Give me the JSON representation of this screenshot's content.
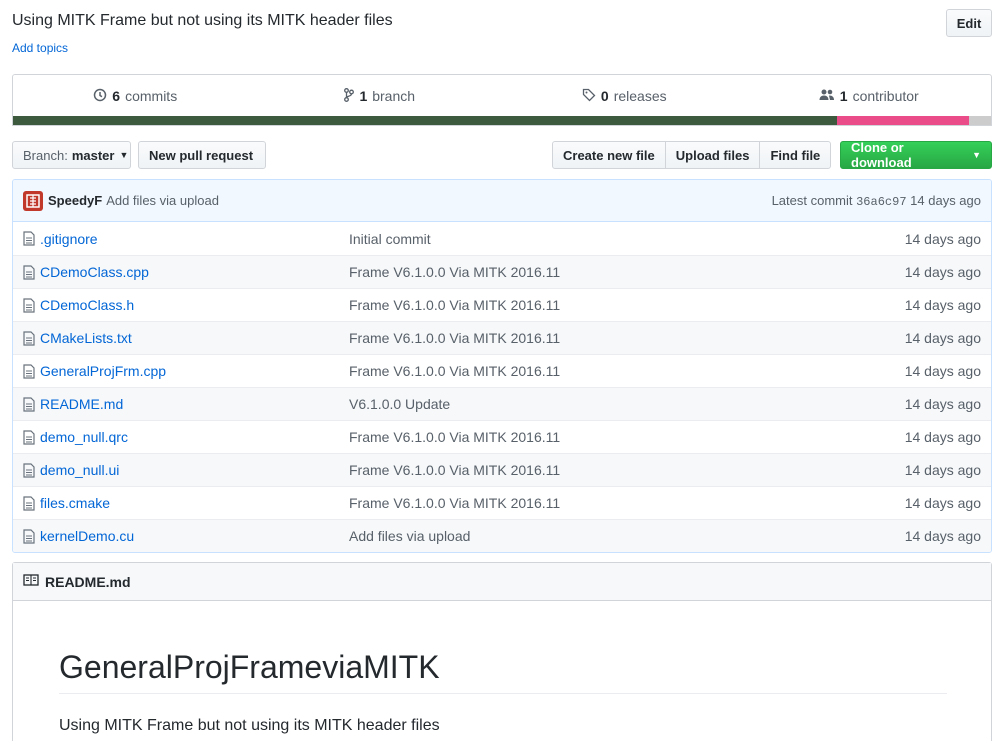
{
  "repo": {
    "description": "Using MITK Frame but not using its MITK header files",
    "add_topics": "Add topics",
    "edit_label": "Edit"
  },
  "summary": {
    "commits_count": "6",
    "commits_label": "commits",
    "branch_count": "1",
    "branch_label": "branch",
    "releases_count": "0",
    "releases_label": "releases",
    "contributor_count": "1",
    "contributor_label": "contributor",
    "language_colors": [
      "#3d5a3e",
      "#ea4c89",
      "#cccccc"
    ],
    "language_fractions": [
      0.843,
      0.135,
      0.022
    ]
  },
  "toolbar": {
    "branch_prefix": "Branch:",
    "branch_name": "master",
    "new_pr": "New pull request",
    "create_file": "Create new file",
    "upload_files": "Upload files",
    "find_file": "Find file",
    "clone": "Clone or download"
  },
  "latest_commit": {
    "author": "SpeedyF",
    "message": "Add files via upload",
    "label": "Latest commit",
    "sha": "36a6c97",
    "age": "14 days ago"
  },
  "files": [
    {
      "name": ".gitignore",
      "message": "Initial commit",
      "age": "14 days ago"
    },
    {
      "name": "CDemoClass.cpp",
      "message": "Frame V6.1.0.0 Via MITK 2016.11",
      "age": "14 days ago"
    },
    {
      "name": "CDemoClass.h",
      "message": "Frame V6.1.0.0 Via MITK 2016.11",
      "age": "14 days ago"
    },
    {
      "name": "CMakeLists.txt",
      "message": "Frame V6.1.0.0 Via MITK 2016.11",
      "age": "14 days ago"
    },
    {
      "name": "GeneralProjFrm.cpp",
      "message": "Frame V6.1.0.0 Via MITK 2016.11",
      "age": "14 days ago"
    },
    {
      "name": "README.md",
      "message": "V6.1.0.0 Update",
      "age": "14 days ago"
    },
    {
      "name": "demo_null.qrc",
      "message": "Frame V6.1.0.0 Via MITK 2016.11",
      "age": "14 days ago"
    },
    {
      "name": "demo_null.ui",
      "message": "Frame V6.1.0.0 Via MITK 2016.11",
      "age": "14 days ago"
    },
    {
      "name": "files.cmake",
      "message": "Frame V6.1.0.0 Via MITK 2016.11",
      "age": "14 days ago"
    },
    {
      "name": "kernelDemo.cu",
      "message": "Add files via upload",
      "age": "14 days ago"
    }
  ],
  "readme": {
    "filename": "README.md",
    "title": "GeneralProjFrameviaMITK",
    "text": "Using MITK Frame but not using its MITK header files"
  }
}
